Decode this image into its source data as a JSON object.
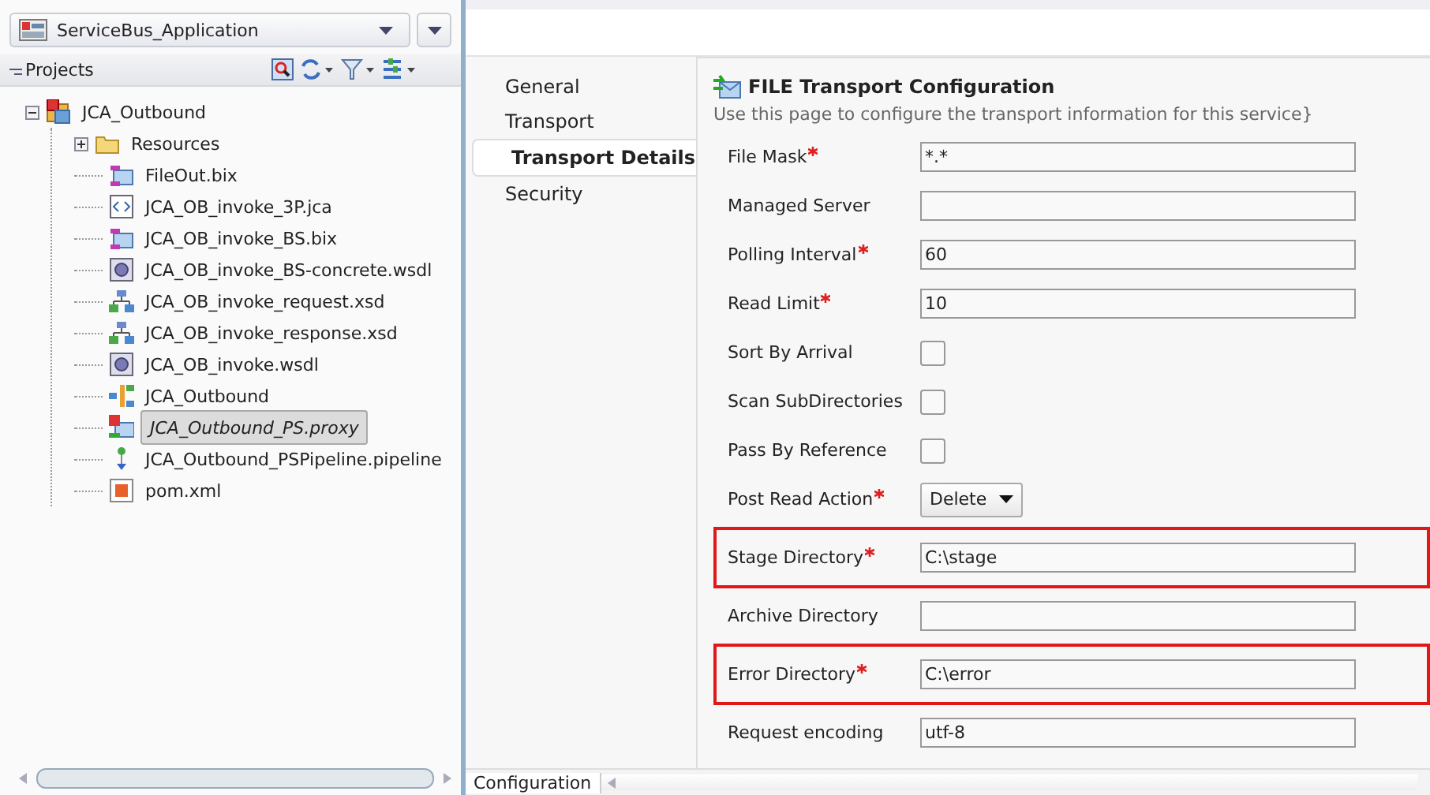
{
  "application": {
    "name": "ServiceBus_Application"
  },
  "projects_panel": {
    "title": "Projects"
  },
  "tree": [
    {
      "label": "JCA_Outbound",
      "kind": "project",
      "selected": false,
      "expanded": true,
      "children": [
        {
          "label": "Resources",
          "kind": "folder",
          "selected": false,
          "expanded": false
        },
        {
          "label": "FileOut.bix",
          "kind": "bix",
          "selected": false
        },
        {
          "label": "JCA_OB_invoke_3P.jca",
          "kind": "jca",
          "selected": false
        },
        {
          "label": "JCA_OB_invoke_BS.bix",
          "kind": "bix",
          "selected": false
        },
        {
          "label": "JCA_OB_invoke_BS-concrete.wsdl",
          "kind": "wsdl",
          "selected": false
        },
        {
          "label": "JCA_OB_invoke_request.xsd",
          "kind": "xsd",
          "selected": false
        },
        {
          "label": "JCA_OB_invoke_response.xsd",
          "kind": "xsd",
          "selected": false
        },
        {
          "label": "JCA_OB_invoke.wsdl",
          "kind": "wsdl",
          "selected": false
        },
        {
          "label": "JCA_Outbound",
          "kind": "flow",
          "selected": false
        },
        {
          "label": "JCA_Outbound_PS.proxy",
          "kind": "proxy",
          "selected": true
        },
        {
          "label": "JCA_Outbound_PSPipeline.pipeline",
          "kind": "pipeline",
          "selected": false
        },
        {
          "label": "pom.xml",
          "kind": "pom",
          "selected": false
        }
      ]
    }
  ],
  "nav": [
    {
      "label": "General",
      "selected": false
    },
    {
      "label": "Transport",
      "selected": false
    },
    {
      "label": "Transport Details",
      "selected": true
    },
    {
      "label": "Security",
      "selected": false
    }
  ],
  "form": {
    "title": "FILE Transport Configuration",
    "description": "Use this page to configure the transport information for this service}",
    "fields": [
      {
        "label": "File Mask",
        "kind": "text",
        "required": true,
        "highlighted": false,
        "value": "*.*"
      },
      {
        "label": "Managed Server",
        "kind": "text",
        "required": false,
        "highlighted": false
      },
      {
        "label": "Polling Interval",
        "kind": "text",
        "required": true,
        "highlighted": false,
        "value": "60"
      },
      {
        "label": "Read Limit",
        "kind": "text",
        "required": true,
        "highlighted": false,
        "value": "10"
      },
      {
        "label": "Sort By Arrival",
        "kind": "checkbox",
        "required": false,
        "highlighted": false,
        "checked": false
      },
      {
        "label": "Scan SubDirectories",
        "kind": "checkbox",
        "required": false,
        "highlighted": false,
        "checked": false
      },
      {
        "label": "Pass By Reference",
        "kind": "checkbox",
        "required": false,
        "highlighted": false,
        "checked": false
      },
      {
        "label": "Post Read Action",
        "kind": "select",
        "required": true,
        "highlighted": false,
        "value": "Delete"
      },
      {
        "label": "Stage Directory",
        "kind": "text",
        "required": true,
        "highlighted": true,
        "value": "C:\\stage"
      },
      {
        "label": "Archive Directory",
        "kind": "text",
        "required": false,
        "highlighted": false
      },
      {
        "label": "Error Directory",
        "kind": "text",
        "required": true,
        "highlighted": true,
        "value": "C:\\error"
      },
      {
        "label": "Request encoding",
        "kind": "text",
        "required": false,
        "highlighted": false,
        "value": "utf-8"
      }
    ]
  },
  "bottom_tabs": [
    {
      "label": "Configuration"
    }
  ]
}
